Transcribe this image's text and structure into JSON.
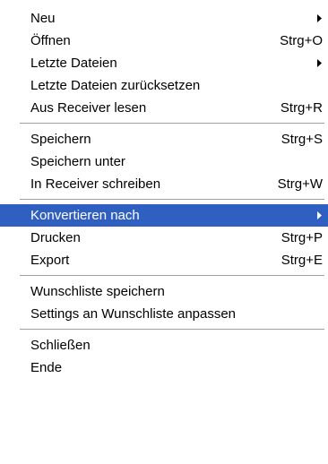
{
  "menu": {
    "groups": [
      [
        {
          "label": "Neu",
          "shortcut": "",
          "submenu": true
        },
        {
          "label": "Öffnen",
          "shortcut": "Strg+O",
          "submenu": false
        },
        {
          "label": "Letzte Dateien",
          "shortcut": "",
          "submenu": true
        },
        {
          "label": "Letzte Dateien zurücksetzen",
          "shortcut": "",
          "submenu": false
        },
        {
          "label": "Aus Receiver lesen",
          "shortcut": "Strg+R",
          "submenu": false
        }
      ],
      [
        {
          "label": "Speichern",
          "shortcut": "Strg+S",
          "submenu": false
        },
        {
          "label": "Speichern unter",
          "shortcut": "",
          "submenu": false
        },
        {
          "label": "In Receiver schreiben",
          "shortcut": "Strg+W",
          "submenu": false
        }
      ],
      [
        {
          "label": "Konvertieren nach",
          "shortcut": "",
          "submenu": true,
          "highlighted": true
        },
        {
          "label": "Drucken",
          "shortcut": "Strg+P",
          "submenu": false
        },
        {
          "label": "Export",
          "shortcut": "Strg+E",
          "submenu": false
        }
      ],
      [
        {
          "label": "Wunschliste speichern",
          "shortcut": "",
          "submenu": false
        },
        {
          "label": "Settings an Wunschliste anpassen",
          "shortcut": "",
          "submenu": false
        }
      ],
      [
        {
          "label": "Schließen",
          "shortcut": "",
          "submenu": false
        },
        {
          "label": "Ende",
          "shortcut": "",
          "submenu": false
        }
      ]
    ]
  },
  "colors": {
    "highlight_bg": "#2f5fc0",
    "highlight_text": "#ffffff",
    "separator": "#a0a0a0",
    "background": "#ffffff"
  },
  "icons": {
    "submenu": "submenu-arrow-icon"
  }
}
